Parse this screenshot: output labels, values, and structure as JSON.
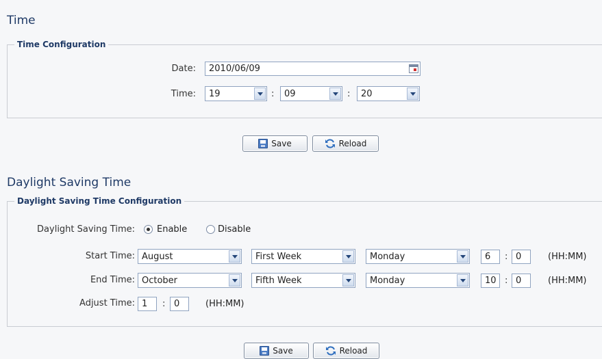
{
  "time_section": {
    "title": "Time",
    "group_title": "Time Configuration",
    "date_label": "Date:",
    "date_value": "2010/06/09",
    "time_label": "Time:",
    "hour": "19",
    "minute": "09",
    "second": "20",
    "colon": ":",
    "save_label": "Save",
    "reload_label": "Reload"
  },
  "dst_section": {
    "title": "Daylight Saving Time",
    "group_title": "Daylight Saving Time Configuration",
    "dst_label": "Daylight Saving Time:",
    "enable_label": "Enable",
    "disable_label": "Disable",
    "dst_enabled": true,
    "start_label": "Start Time:",
    "start_month": "August",
    "start_week": "First Week",
    "start_day": "Monday",
    "start_hour": "6",
    "start_minute": "0",
    "end_label": "End Time:",
    "end_month": "October",
    "end_week": "Fifth Week",
    "end_day": "Monday",
    "end_hour": "10",
    "end_minute": "0",
    "adjust_label": "Adjust Time:",
    "adjust_hour": "1",
    "adjust_minute": "0",
    "colon": ":",
    "hhmm": "(HH:MM)",
    "save_label": "Save",
    "reload_label": "Reload"
  },
  "icons": {
    "calendar": "calendar-icon",
    "dropdown": "chevron-down-icon",
    "save": "floppy-disk-icon",
    "reload": "reload-icon"
  }
}
